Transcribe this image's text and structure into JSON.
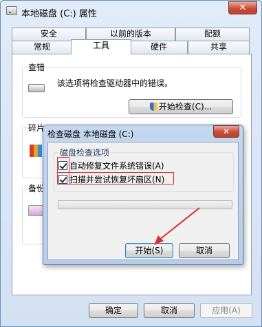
{
  "window": {
    "title": "本地磁盘 (C:) 属性",
    "close": "✕"
  },
  "tabs": {
    "row1": [
      "安全",
      "以前的版本",
      "配额"
    ],
    "row2": [
      "常规",
      "工具",
      "硬件",
      "共享"
    ],
    "active": "工具"
  },
  "error_check": {
    "label": "查错",
    "description": "该选项将检查驱动器中的错误。",
    "button": "开始检查(C)..."
  },
  "defrag": {
    "label": "碎片"
  },
  "backup": {
    "label": "备份"
  },
  "footer": {
    "ok": "确定",
    "cancel": "取消",
    "apply": "应用(A)"
  },
  "dialog": {
    "title": "检查磁盘 本地磁盘 (C:)",
    "close": "✕",
    "group_label": "磁盘检查选项",
    "option1": "自动修复文件系统错误(A)",
    "option1_checked": true,
    "option2": "扫描并尝试恢复坏扇区(N)",
    "option2_checked": true,
    "progress": 0,
    "start": "开始(S)",
    "cancel": "取消"
  },
  "colors": {
    "highlight": "#e02b2b"
  }
}
